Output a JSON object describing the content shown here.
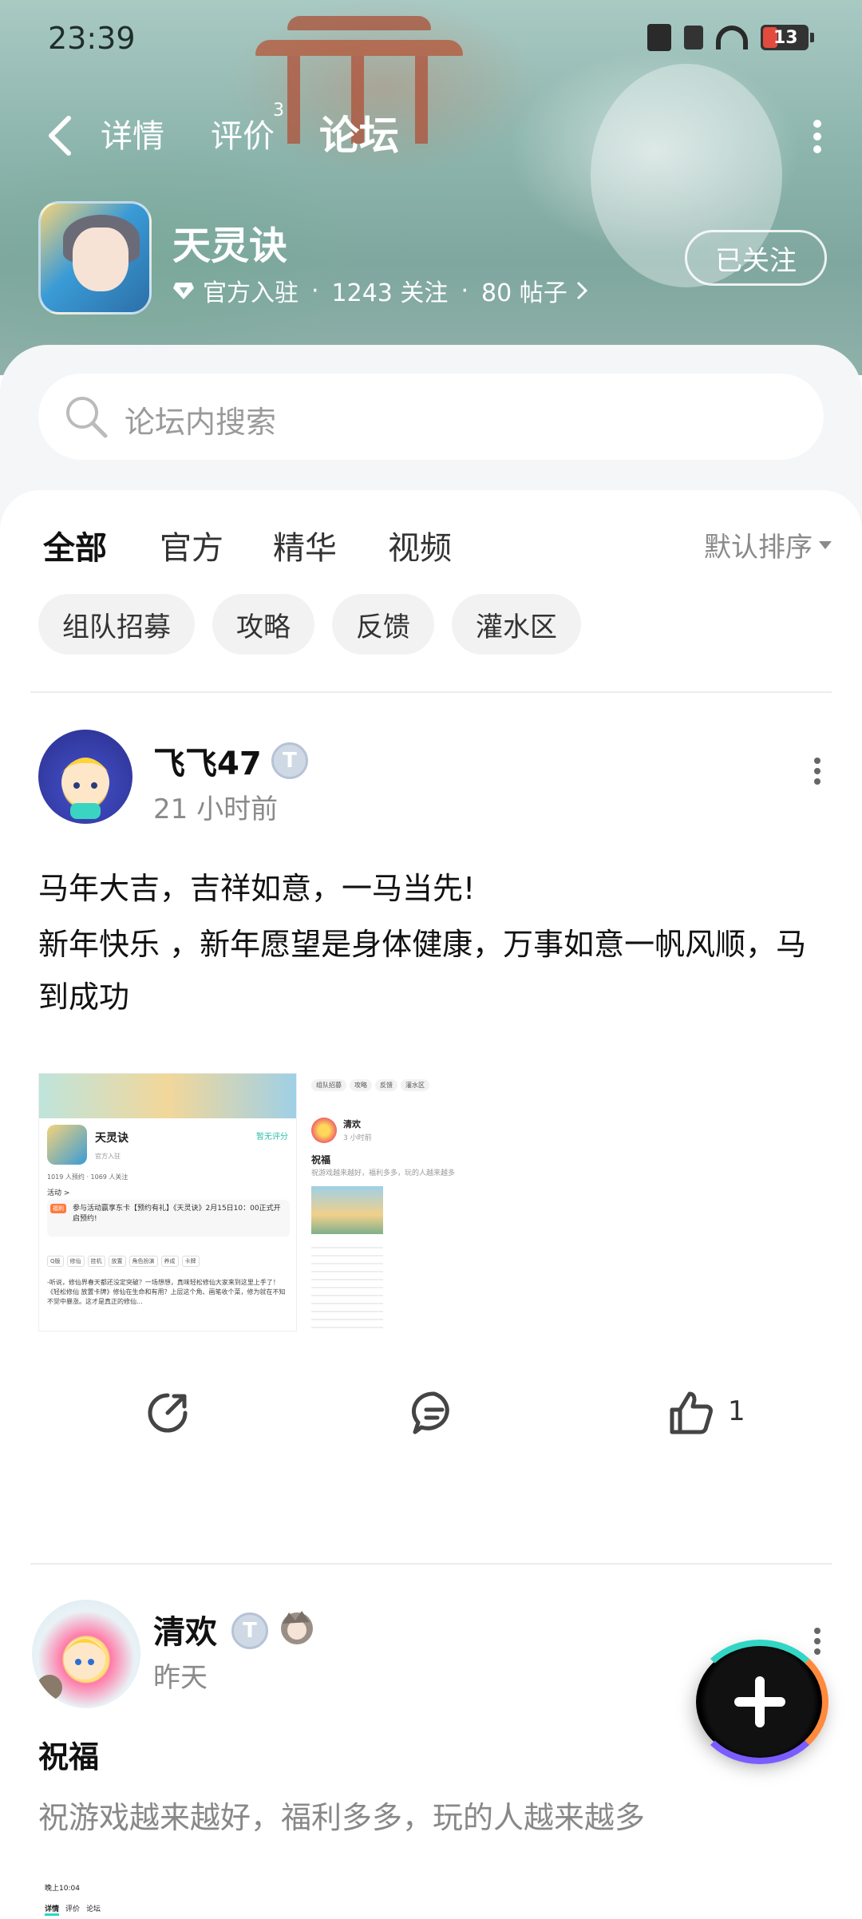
{
  "status_bar": {
    "time": "23:39",
    "battery": "13"
  },
  "nav": {
    "tabs": [
      {
        "label": "详情"
      },
      {
        "label": "评价",
        "badge": "3"
      },
      {
        "label": "论坛"
      }
    ]
  },
  "game": {
    "name": "天灵诀",
    "verified_label": "官方入驻",
    "followers": "1243 关注",
    "posts": "80 帖子",
    "separator": "·",
    "follow_button": "已关注"
  },
  "search": {
    "placeholder": "论坛内搜索"
  },
  "filter_tabs": [
    "全部",
    "官方",
    "精华",
    "视频"
  ],
  "sort_label": "默认排序",
  "chips": [
    "组队招募",
    "攻略",
    "反馈",
    "灌水区"
  ],
  "posts": [
    {
      "author": "飞飞47",
      "time": "21 小时前",
      "title": "马年大吉，吉祥如意，一马当先!",
      "body": "新年快乐 ，新年愿望是身体健康，万事如意一帆风顺，马到成功",
      "likes": "1"
    },
    {
      "author": "清欢",
      "time": "昨天",
      "title": "祝福",
      "body": "祝游戏越来越好，福利多多，玩的人越来越多"
    }
  ],
  "thumb1": {
    "title": "天灵诀",
    "rating": "暂无评分",
    "verified": "官方入驻",
    "stats": "1019 人预约 · 1069 人关注",
    "activity": "活动 >",
    "event_tag": "福利",
    "event_text": "参与活动赢享东卡【预约有礼】《天灵诀》2月15日10：00正式开启预约!",
    "tags": [
      "Q版",
      "修仙",
      "挂机",
      "放置",
      "角色扮演",
      "养成",
      "卡牌"
    ],
    "excerpt": "-听说，修仙界春天都还没定突破？一场想想，真味轻松修仙大家来到这里上手了！《轻松修仙 放置卡牌》修仙在生命和有用？上层这个角、画笔收个菜，修为就在不知不觉中暴涨。这才是真正的修仙..."
  },
  "thumb2": {
    "chips": [
      "组队招募",
      "攻略",
      "反馈",
      "灌水区"
    ],
    "author": "清欢",
    "time": "3 小时前",
    "title": "祝福",
    "body": "祝游戏越来越好，福利多多，玩的人越来越多"
  },
  "thumb3": {
    "time": "晚上10:04",
    "tabs": [
      "详情",
      "评价",
      "论坛"
    ]
  },
  "colors": {
    "accent": "#2fd3c2",
    "banner": "#8cb5ad"
  }
}
